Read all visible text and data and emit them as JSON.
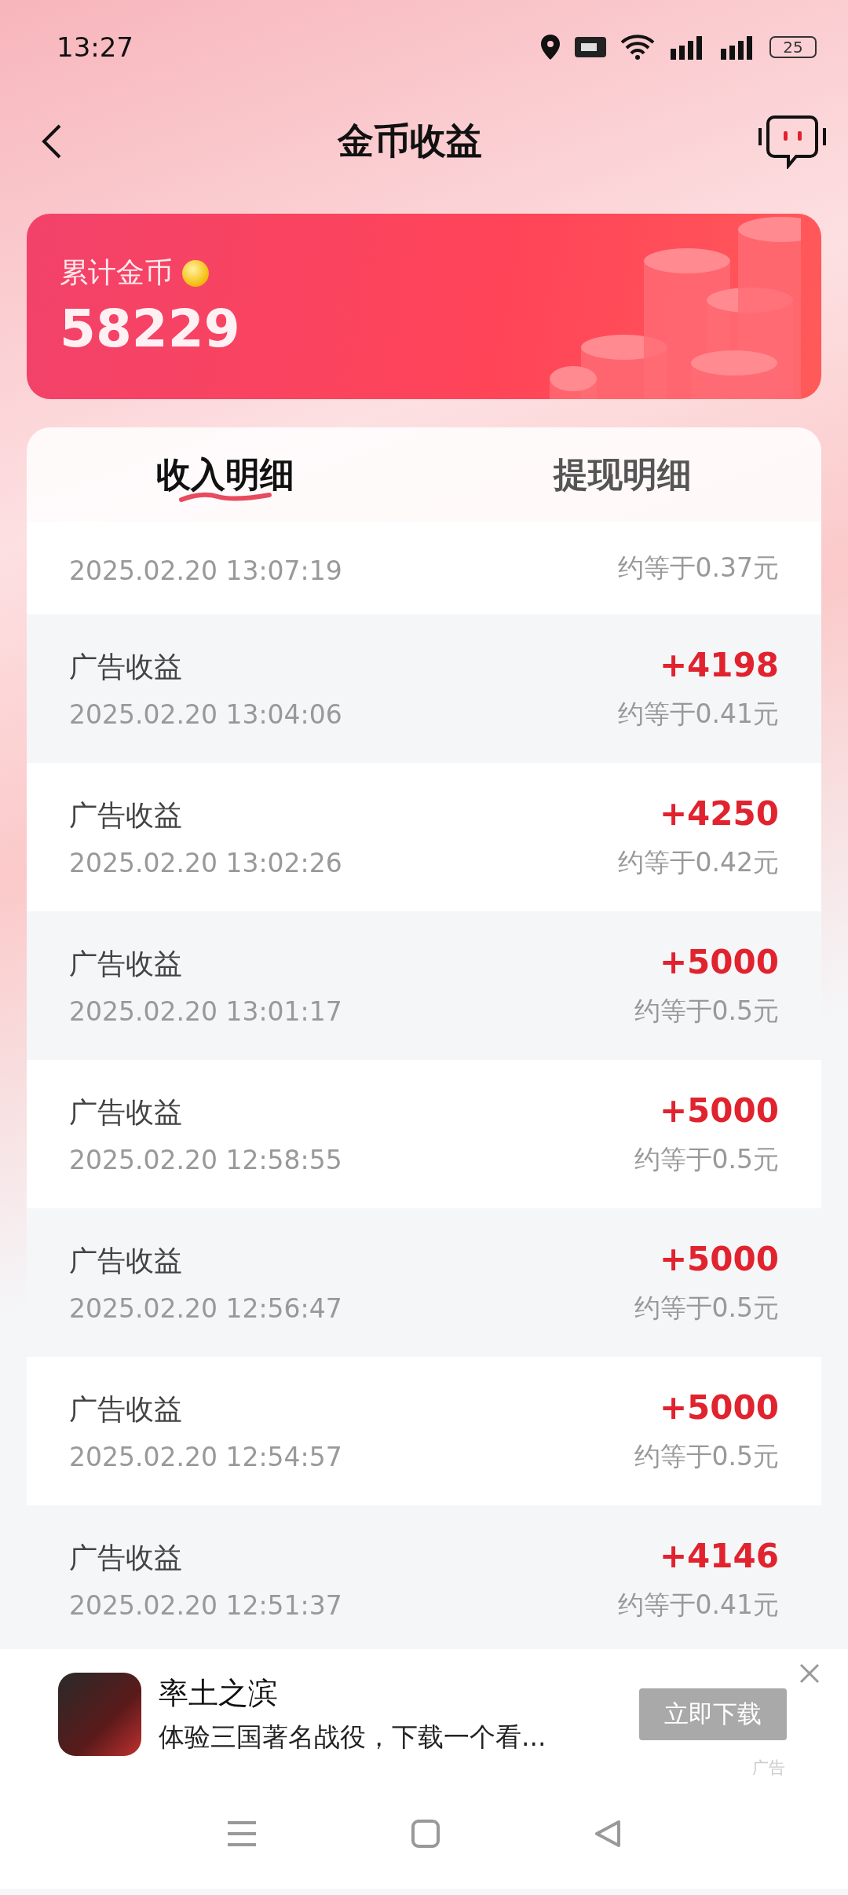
{
  "status_bar": {
    "time": "13:27",
    "battery": "25"
  },
  "header": {
    "title": "金币收益"
  },
  "summary": {
    "label": "累计金币",
    "value": "58229"
  },
  "tabs": [
    {
      "label": "收入明细",
      "selected": true
    },
    {
      "label": "提现明细",
      "selected": false
    }
  ],
  "partial_row": {
    "time": "2025.02.20 13:07:19",
    "approx": "约等于0.37元"
  },
  "rows": [
    {
      "title": "广告收益",
      "time": "2025.02.20 13:04:06",
      "amount": "+4198",
      "approx": "约等于0.41元"
    },
    {
      "title": "广告收益",
      "time": "2025.02.20 13:02:26",
      "amount": "+4250",
      "approx": "约等于0.42元"
    },
    {
      "title": "广告收益",
      "time": "2025.02.20 13:01:17",
      "amount": "+5000",
      "approx": "约等于0.5元"
    },
    {
      "title": "广告收益",
      "time": "2025.02.20 12:58:55",
      "amount": "+5000",
      "approx": "约等于0.5元"
    },
    {
      "title": "广告收益",
      "time": "2025.02.20 12:56:47",
      "amount": "+5000",
      "approx": "约等于0.5元"
    },
    {
      "title": "广告收益",
      "time": "2025.02.20 12:54:57",
      "amount": "+5000",
      "approx": "约等于0.5元"
    },
    {
      "title": "广告收益",
      "time": "2025.02.20 12:51:37",
      "amount": "+4146",
      "approx": "约等于0.41元"
    }
  ],
  "ad": {
    "title": "率土之滨",
    "description": "体验三国著名战役，下载一个看...",
    "button": "立即下载",
    "tag": "广告"
  }
}
